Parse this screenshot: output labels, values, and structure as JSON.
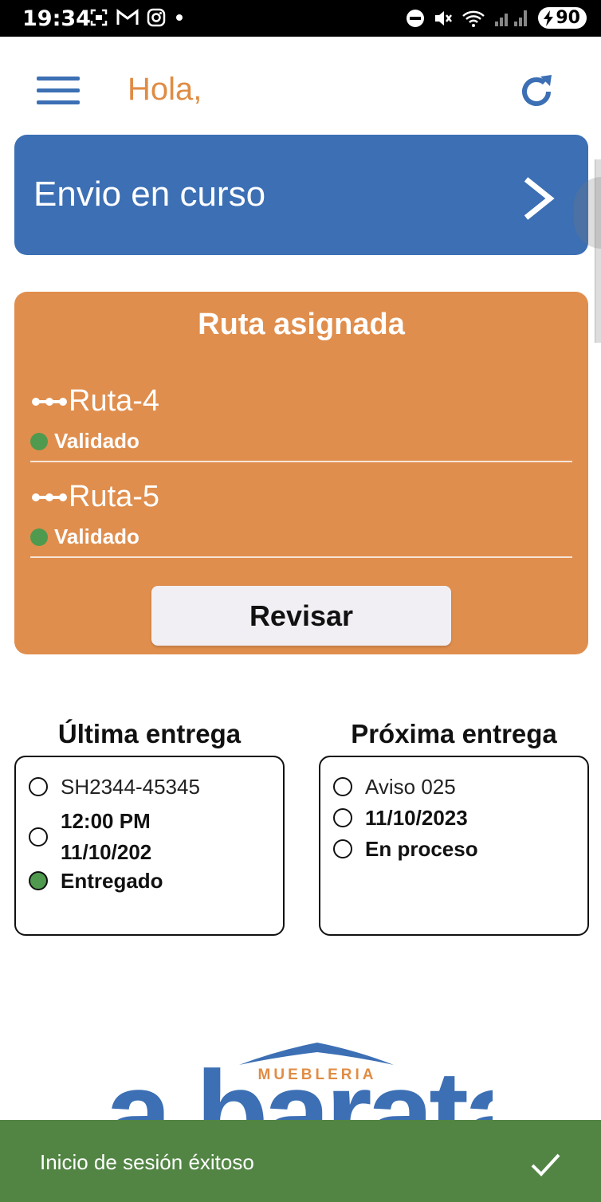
{
  "status_bar": {
    "time": "19:34",
    "battery": "90",
    "icons": [
      "screenshot-icon",
      "gmail-icon",
      "instagram-icon",
      "dot-icon",
      "dnd-icon",
      "mute-icon",
      "wifi-icon",
      "signal-icon",
      "battery-icon"
    ]
  },
  "header": {
    "greeting": "Hola,",
    "menu_icon": "hamburger-menu-icon",
    "refresh_icon": "refresh-icon"
  },
  "envio": {
    "label": "Envio en curso",
    "icon": "chevron-right-icon"
  },
  "ruta_card": {
    "title": "Ruta asignada",
    "routes": [
      {
        "name": "Ruta-4",
        "status": "Validado"
      },
      {
        "name": "Ruta-5",
        "status": "Validado"
      }
    ],
    "button_label": "Revisar"
  },
  "ultima": {
    "title": "Última entrega",
    "id": "SH2344-45345",
    "time": "12:00 PM",
    "date": "11/10/202",
    "status": "Entregado"
  },
  "proxima": {
    "title": "Próxima entrega",
    "id": "Aviso 025",
    "date": "11/10/2023",
    "status": "En proceso"
  },
  "logo": {
    "top_text": "MUEBLERIA",
    "main_text": "la barata"
  },
  "snackbar": {
    "message": "Inicio de sesión éxitoso",
    "icon": "check-icon"
  },
  "colors": {
    "blue": "#3c6fb4",
    "orange": "#e08e4d",
    "green": "#528544",
    "status_green": "#4f9a4f"
  }
}
